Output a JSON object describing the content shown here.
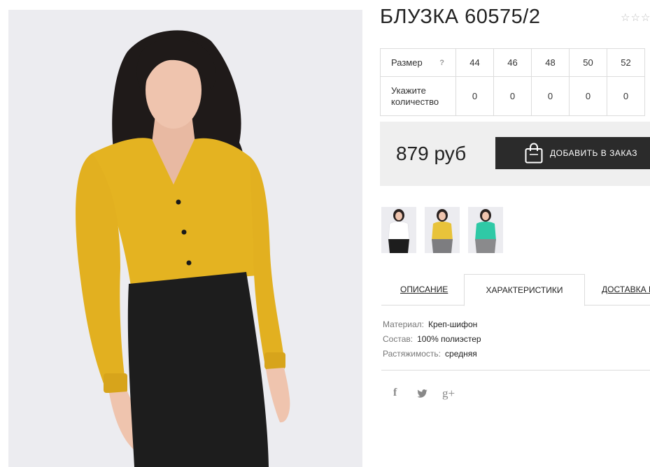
{
  "product": {
    "title": "БЛУЗКА 60575/2",
    "rating_stars": "☆☆☆"
  },
  "sizes": {
    "size_label": "Размер",
    "help": "?",
    "qty_label": "Укажите количество",
    "values": [
      "44",
      "46",
      "48",
      "50",
      "52"
    ],
    "quantities": [
      "0",
      "0",
      "0",
      "0",
      "0"
    ]
  },
  "purchase": {
    "price": "879 руб",
    "add_button": "ДОБАВИТЬ В ЗАКАЗ"
  },
  "thumbnails": [
    {
      "color": "#ffffff",
      "icon": "white-blouse-thumbnail"
    },
    {
      "color": "#e8c33a",
      "icon": "yellow-blouse-thumbnail"
    },
    {
      "color": "#2fc9a6",
      "icon": "mint-blouse-thumbnail"
    }
  ],
  "tabs": [
    {
      "label": "ОПИСАНИЕ",
      "active": false
    },
    {
      "label": "ХАРАКТЕРИСТИКИ",
      "active": true
    },
    {
      "label": "ДОСТАВКА И",
      "active": false
    }
  ],
  "characteristics": [
    {
      "key": "Материал:",
      "value": "Креп-шифон"
    },
    {
      "key": "Состав:",
      "value": "100% полиэстер"
    },
    {
      "key": "Растяжимость:",
      "value": "средняя"
    }
  ],
  "social": {
    "facebook": "f",
    "twitter": "twitter-icon",
    "googleplus": "g+"
  },
  "colors": {
    "blouse": "#e4b321",
    "skirt": "#1d1d1d",
    "button": "#2b2b2b",
    "price_bg": "#efefef"
  }
}
